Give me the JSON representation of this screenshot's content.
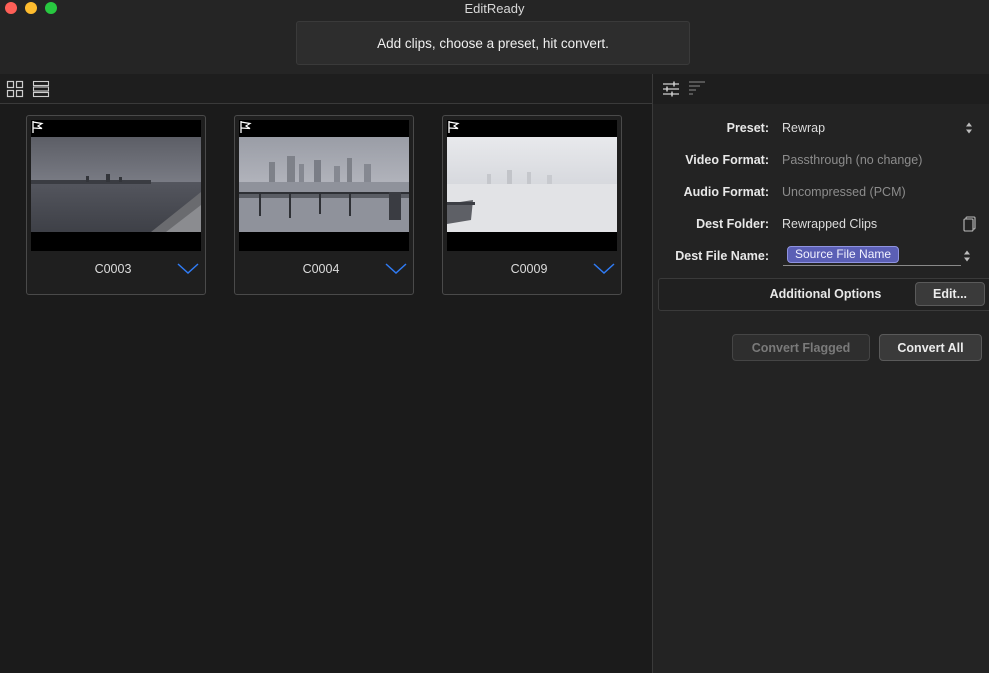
{
  "window": {
    "title": "EditReady",
    "status_message": "Add clips, choose a preset, hit convert."
  },
  "toolbar": {
    "views": [
      "grid-view",
      "list-view"
    ],
    "right_tabs": [
      "settings-sliders",
      "metadata"
    ]
  },
  "clips": [
    {
      "name": "C0003",
      "flagged": false
    },
    {
      "name": "C0004",
      "flagged": false
    },
    {
      "name": "C0009",
      "flagged": false
    }
  ],
  "settings": {
    "preset_label": "Preset:",
    "preset_value": "Rewrap",
    "video_format_label": "Video Format:",
    "video_format_value": "Passthrough (no change)",
    "audio_format_label": "Audio Format:",
    "audio_format_value": "Uncompressed (PCM)",
    "dest_folder_label": "Dest Folder:",
    "dest_folder_value": "Rewrapped Clips",
    "dest_file_name_label": "Dest File Name:",
    "dest_file_name_token": "Source File Name",
    "additional_options_label": "Additional Options",
    "edit_button": "Edit...",
    "convert_flagged_button": "Convert Flagged",
    "convert_all_button": "Convert All"
  },
  "colors": {
    "background": "#1b1b1b",
    "panel": "#232323",
    "token": "#5b5fb5",
    "accent_chevron": "#2f7bf5"
  }
}
